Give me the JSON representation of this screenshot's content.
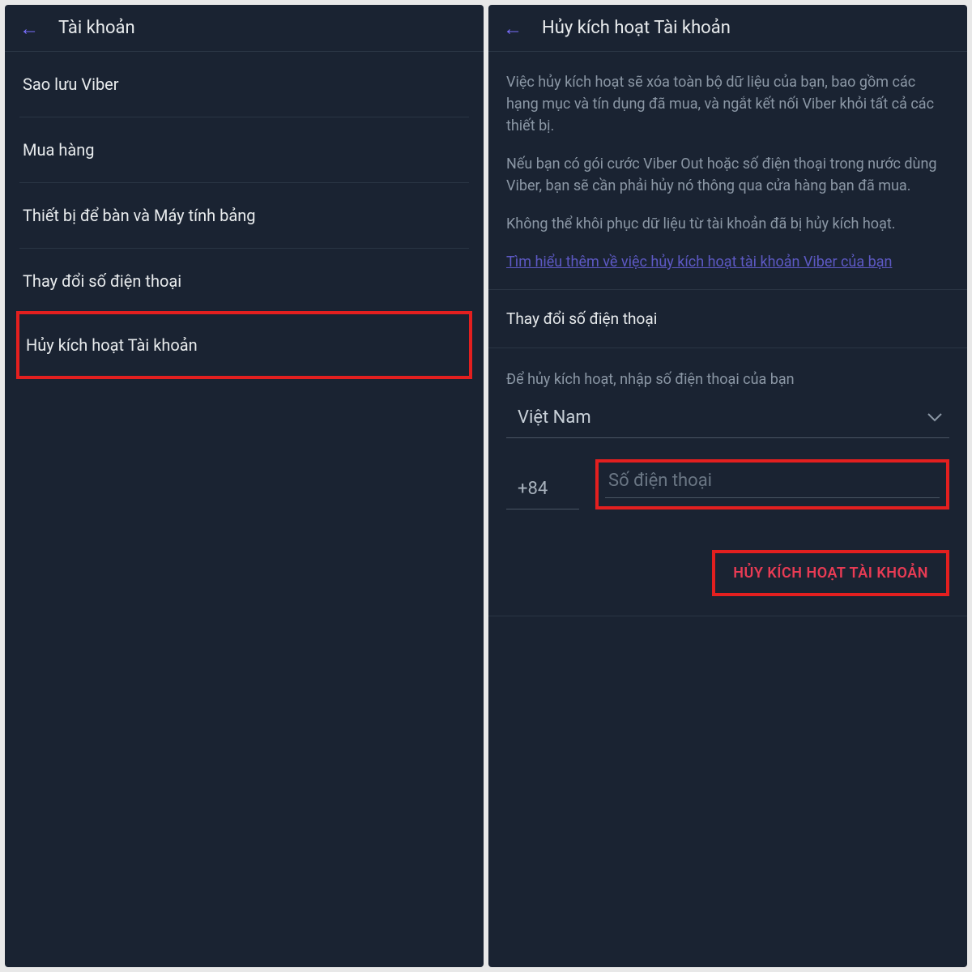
{
  "left": {
    "header": {
      "title": "Tài khoản"
    },
    "menu": [
      "Sao lưu Viber",
      "Mua hàng",
      "Thiết bị để bàn và Máy tính bảng",
      "Thay đổi số điện thoại",
      "Hủy kích hoạt Tài khoản"
    ]
  },
  "right": {
    "header": {
      "title": "Hủy kích hoạt Tài khoản"
    },
    "info": {
      "p1": "Việc hủy kích hoạt sẽ xóa toàn bộ dữ liệu của bạn, bao gồm các hạng mục và tín dụng đã mua, và ngắt kết nối Viber khỏi tất cả các thiết bị.",
      "p2": "Nếu bạn có gói cước Viber Out hoặc số điện thoại trong nước dùng Viber, bạn sẽ cần phải hủy nó thông qua cửa hàng bạn đã mua.",
      "p3": "Không thể khôi phục dữ liệu từ tài khoản đã bị hủy kích hoạt.",
      "link": "Tìm hiểu thêm về việc hủy kích hoạt tài khoản Viber của bạn"
    },
    "section": {
      "title": "Thay đổi số điện thoại"
    },
    "form": {
      "label": "Để hủy kích hoạt, nhập số điện thoại của bạn",
      "country": "Việt Nam",
      "code": "+84",
      "phone_placeholder": "Số điện thoại"
    },
    "button": {
      "label": "HỦY KÍCH HOẠT TÀI KHOẢN"
    }
  }
}
